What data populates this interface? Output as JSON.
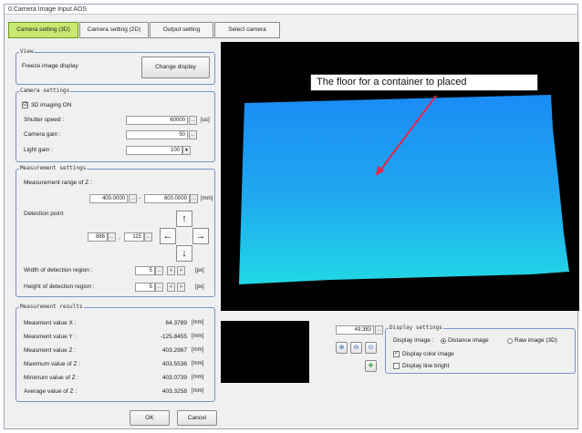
{
  "window": {
    "title": "0.Camera Image Input AOS"
  },
  "tabs": [
    {
      "label": "Camera setting (3D)"
    },
    {
      "label": "Camera setting (2D)"
    },
    {
      "label": "Output setting"
    },
    {
      "label": "Select camera"
    }
  ],
  "view": {
    "legend": "View",
    "freeze_label": "Freeze image display",
    "change_display_label": "Change display"
  },
  "camera_settings": {
    "legend": "Camera settings",
    "imaging_3d_label": "3D imaging ON",
    "imaging_3d_checked": "☑",
    "shutter_label": "Shutter speed :",
    "shutter_value": "60000",
    "shutter_unit": "[us]",
    "gain_label": "Camera gain :",
    "gain_value": "50",
    "light_label": "Light gain :",
    "light_value": "100"
  },
  "measurement_settings": {
    "legend": "Measurement settings",
    "range_label": "Measurement range of Z :",
    "range_min": "400.0000",
    "range_max": "600.0000",
    "range_unit": "[mm]",
    "detection_label": "Detection point",
    "point_x": "886",
    "point_y": "115",
    "width_label": "Width of detection region :",
    "width_value": "5",
    "height_label": "Height of detection region :",
    "height_value": "5",
    "px_unit": "[px]"
  },
  "measurement_results": {
    "legend": "Measurement results",
    "rows": [
      {
        "label": "Measment value X :",
        "value": "64.3789",
        "unit": "[mm]"
      },
      {
        "label": "Measment value Y :",
        "value": "-125.8455",
        "unit": "[mm]"
      },
      {
        "label": "Measment value Z :",
        "value": "403.2967",
        "unit": "[mm]"
      },
      {
        "label": "Maximum value of Z :",
        "value": "403.5536",
        "unit": "[mm]"
      },
      {
        "label": "Minimum value of Z :",
        "value": "403.0739",
        "unit": "[mm]"
      },
      {
        "label": "Average value of Z :",
        "value": "403.3258",
        "unit": "[mm]"
      }
    ]
  },
  "image_annotation": "The floor for a container to placed",
  "zoom_value": "49.383",
  "display_settings": {
    "legend": "Display settings",
    "image_label": "Display image :",
    "distance_label": "Distance image",
    "raw_label": "Raw image (3D)",
    "color_label": "Display color image",
    "line_bright_label": "Display line bright"
  },
  "footer": {
    "ok_label": "OK",
    "cancel_label": "Cancel"
  },
  "colors": {
    "active_tab": "#c8e870",
    "image_bg": "#000000",
    "surface": "#21b4f0",
    "annotation_arrow": "#e0284b"
  }
}
